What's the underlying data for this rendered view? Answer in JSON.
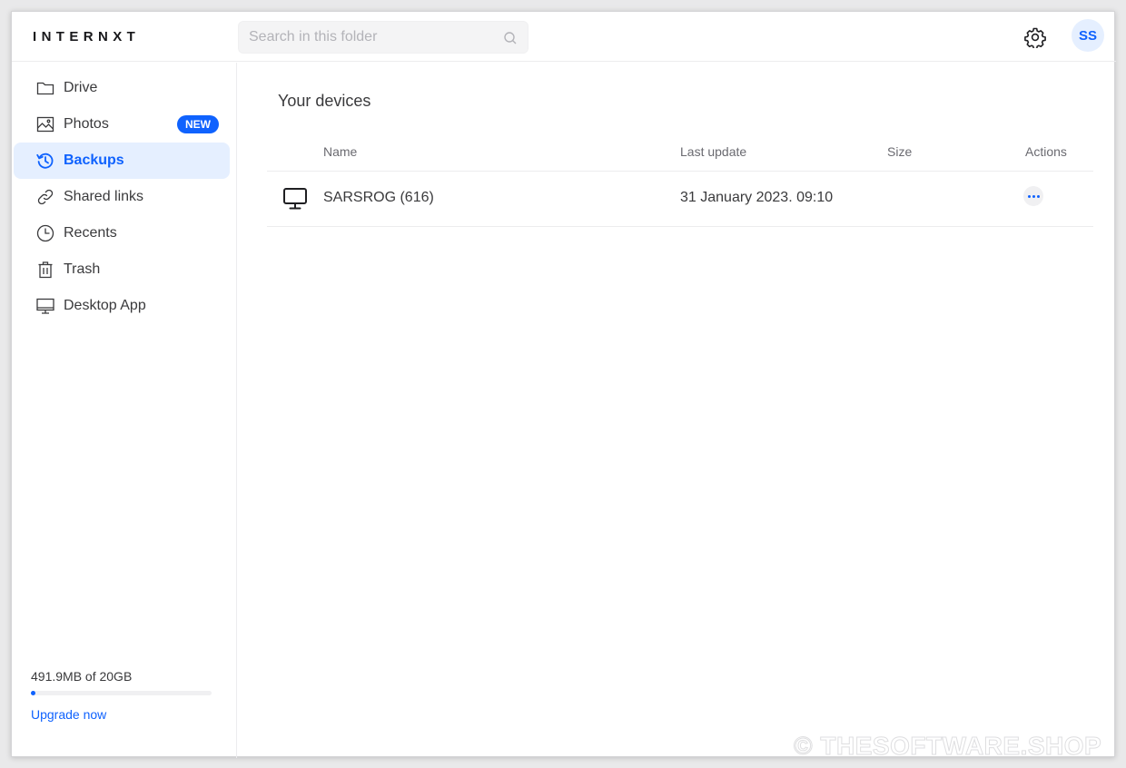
{
  "app": {
    "logo": "INTERNXT"
  },
  "header": {
    "search_placeholder": "Search in this folder",
    "avatar_initials": "SS"
  },
  "sidebar": {
    "items": [
      {
        "label": "Drive",
        "icon": "folder-icon"
      },
      {
        "label": "Photos",
        "icon": "image-icon",
        "badge": "NEW"
      },
      {
        "label": "Backups",
        "icon": "history-icon",
        "active": true
      },
      {
        "label": "Shared links",
        "icon": "link-icon"
      },
      {
        "label": "Recents",
        "icon": "clock-icon"
      },
      {
        "label": "Trash",
        "icon": "trash-icon"
      },
      {
        "label": "Desktop App",
        "icon": "desktop-icon"
      }
    ],
    "storage": {
      "text": "491.9MB of 20GB",
      "used_fraction": 0.024
    },
    "upgrade_label": "Upgrade now"
  },
  "main": {
    "title": "Your devices",
    "columns": {
      "name": "Name",
      "last_update": "Last update",
      "size": "Size",
      "actions": "Actions"
    },
    "rows": [
      {
        "icon": "monitor-icon",
        "name": "SARSROG (616)",
        "last_update": "31 January 2023. 09:10",
        "size": ""
      }
    ]
  },
  "watermark": "© THESOFTWARE.SHOP",
  "colors": {
    "accent": "#0f62fe",
    "active_bg": "#e5efff",
    "text": "#3a3a3c",
    "muted": "#6a6a70"
  }
}
